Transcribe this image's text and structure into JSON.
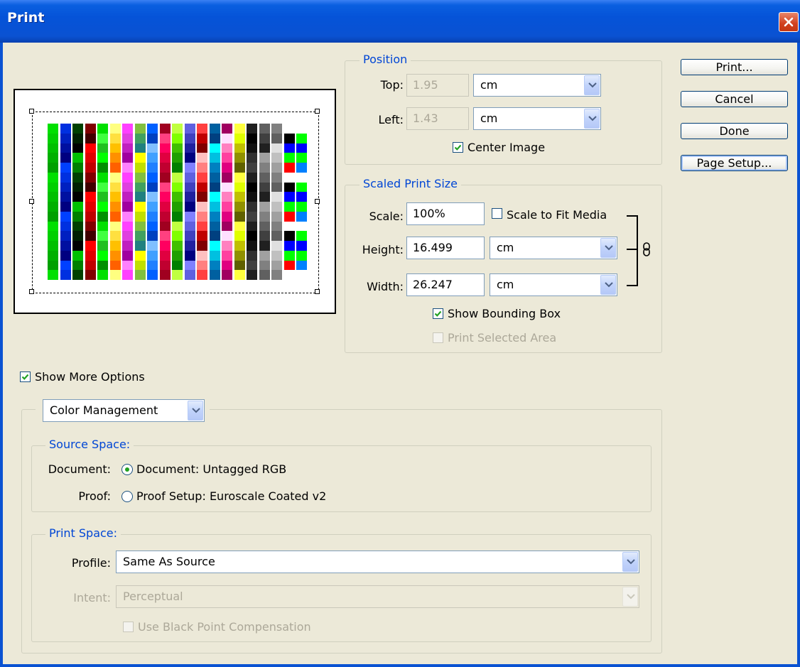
{
  "window": {
    "title": "Print"
  },
  "position": {
    "group_title": "Position",
    "top_label": "Top:",
    "top_value": "1.95",
    "top_unit": "cm",
    "left_label": "Left:",
    "left_value": "1.43",
    "left_unit": "cm",
    "center_image_label": "Center Image",
    "center_image_checked": true
  },
  "scaled": {
    "group_title": "Scaled Print Size",
    "scale_label": "Scale:",
    "scale_value": "100%",
    "fit_label": "Scale to Fit Media",
    "fit_checked": false,
    "height_label": "Height:",
    "height_value": "16.499",
    "height_unit": "cm",
    "width_label": "Width:",
    "width_value": "26.247",
    "width_unit": "cm",
    "bounding_label": "Show Bounding Box",
    "bounding_checked": true,
    "selected_label": "Print Selected Area",
    "selected_checked": false
  },
  "buttons": {
    "print": "Print...",
    "cancel": "Cancel",
    "done": "Done",
    "page_setup": "Page Setup..."
  },
  "more_options": {
    "label": "Show More Options",
    "checked": true
  },
  "mode_select": "Color Management",
  "source": {
    "group_title": "Source Space:",
    "document_label": "Document:",
    "document_option": "Document:  Untagged RGB",
    "proof_label": "Proof:",
    "proof_option": "Proof Setup:  Euroscale Coated v2",
    "selected": "document"
  },
  "print_space": {
    "group_title": "Print Space:",
    "profile_label": "Profile:",
    "profile_value": "Same As Source",
    "intent_label": "Intent:",
    "intent_value": "Perceptual",
    "bpc_label": "Use Black Point Compensation",
    "bpc_checked": false
  },
  "colors": {
    "accent": "#0046d5",
    "title_bar": "#0a52d2",
    "dialog_bg": "#ece9d8",
    "close": "#d1401e"
  }
}
